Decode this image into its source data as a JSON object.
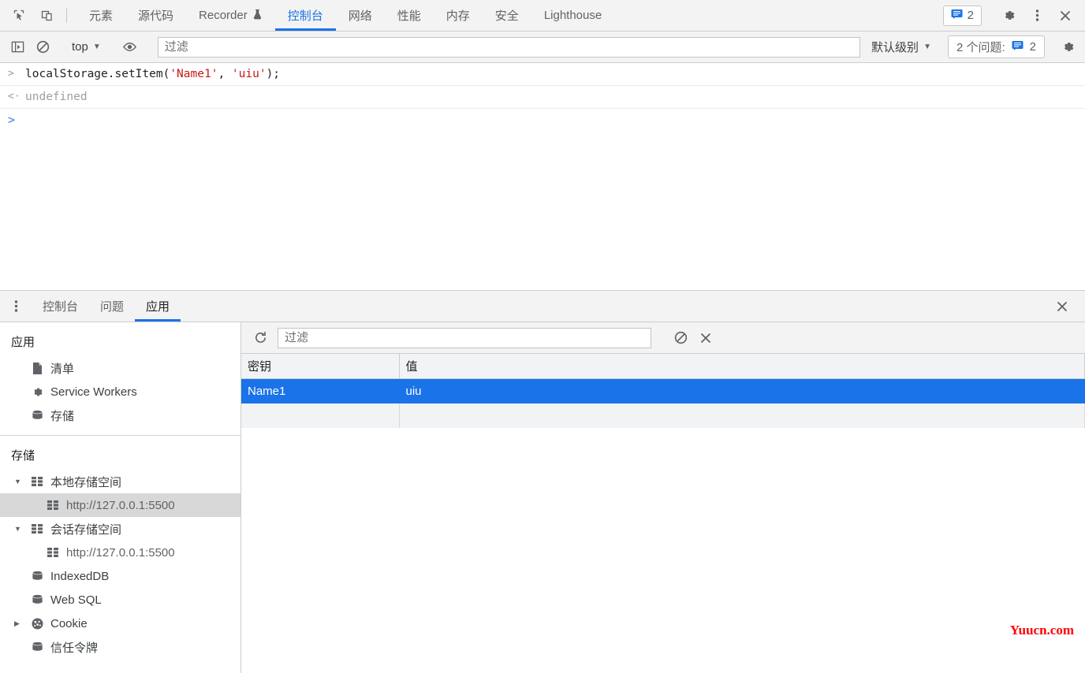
{
  "top_toolbar": {
    "inspect_icon": "inspect-cursor-icon",
    "device_toggle_icon": "device-toolbar-icon",
    "tabs": [
      {
        "label": "元素",
        "active": false
      },
      {
        "label": "源代码",
        "active": false
      },
      {
        "label": "Recorder",
        "active": false,
        "experiment_icon": "flask-icon"
      },
      {
        "label": "控制台",
        "active": true
      },
      {
        "label": "网络",
        "active": false
      },
      {
        "label": "性能",
        "active": false
      },
      {
        "label": "内存",
        "active": false
      },
      {
        "label": "安全",
        "active": false
      },
      {
        "label": "Lighthouse",
        "active": false
      }
    ],
    "message_count": "2",
    "settings_icon": "gear-icon",
    "more_icon": "kebab-menu-icon",
    "close_icon": "close-icon",
    "accent_color": "#1a73e8"
  },
  "console_toolbar": {
    "sidebar_toggle_icon": "console-sidebar-icon",
    "clear_icon": "clear-console-icon",
    "context": "top",
    "eye_icon": "live-expression-icon",
    "filter_placeholder": "过滤",
    "filter_value": "",
    "level": "默认级别",
    "issues_label": "2 个问题:",
    "issues_count": "2",
    "settings_icon": "gear-icon"
  },
  "console": {
    "lines": [
      {
        "type": "input",
        "arrow": ">",
        "tokens": [
          {
            "text": "localStorage.setItem(",
            "kind": "plain"
          },
          {
            "text": "'Name1'",
            "kind": "string"
          },
          {
            "text": ", ",
            "kind": "plain"
          },
          {
            "text": "'uiu'",
            "kind": "string"
          },
          {
            "text": ");",
            "kind": "plain"
          }
        ]
      },
      {
        "type": "output",
        "arrow": "<·",
        "text": "undefined"
      },
      {
        "type": "prompt",
        "arrow": ">",
        "text": ""
      }
    ]
  },
  "drawer": {
    "kebab_icon": "kebab-menu-icon",
    "tabs": [
      {
        "label": "控制台",
        "active": false
      },
      {
        "label": "问题",
        "active": false
      },
      {
        "label": "应用",
        "active": true
      }
    ],
    "close_icon": "close-icon"
  },
  "app_sidebar": {
    "application": {
      "title": "应用",
      "items": [
        {
          "label": "清单",
          "icon": "manifest-document-icon",
          "selected": false
        },
        {
          "label": "Service Workers",
          "icon": "gear-icon",
          "selected": false
        },
        {
          "label": "存储",
          "icon": "database-icon",
          "selected": false
        }
      ]
    },
    "storage": {
      "title": "存储",
      "items": [
        {
          "label": "本地存储空间",
          "icon": "table-grid-icon",
          "twisty": "▼",
          "nested": false,
          "selected": false
        },
        {
          "label": "http://127.0.0.1:5500",
          "icon": "table-grid-icon",
          "twisty": "",
          "nested": true,
          "selected": true
        },
        {
          "label": "会话存储空间",
          "icon": "table-grid-icon",
          "twisty": "▼",
          "nested": false,
          "selected": false
        },
        {
          "label": "http://127.0.0.1:5500",
          "icon": "table-grid-icon",
          "twisty": "",
          "nested": true,
          "selected": false
        },
        {
          "label": "IndexedDB",
          "icon": "database-icon",
          "twisty": "",
          "nested": false,
          "selected": false
        },
        {
          "label": "Web SQL",
          "icon": "database-icon",
          "twisty": "",
          "nested": false,
          "selected": false
        },
        {
          "label": "Cookie",
          "icon": "cookie-icon",
          "twisty": "▶",
          "nested": false,
          "selected": false
        },
        {
          "label": "信任令牌",
          "icon": "database-icon",
          "twisty": "",
          "nested": false,
          "selected": false
        }
      ]
    }
  },
  "storage_panel": {
    "refresh_icon": "refresh-icon",
    "filter_placeholder": "过滤",
    "filter_value": "",
    "clear_all_icon": "clear-all-icon",
    "delete_icon": "delete-selected-icon",
    "columns": [
      "密钥",
      "值"
    ],
    "rows": [
      {
        "key": "Name1",
        "value": "uiu",
        "selected": true
      },
      {
        "key": "",
        "value": "",
        "selected": false
      }
    ],
    "selection_color": "#1a73e8"
  },
  "watermark": {
    "text": "Yuucn.com",
    "color": "#ff0000"
  }
}
